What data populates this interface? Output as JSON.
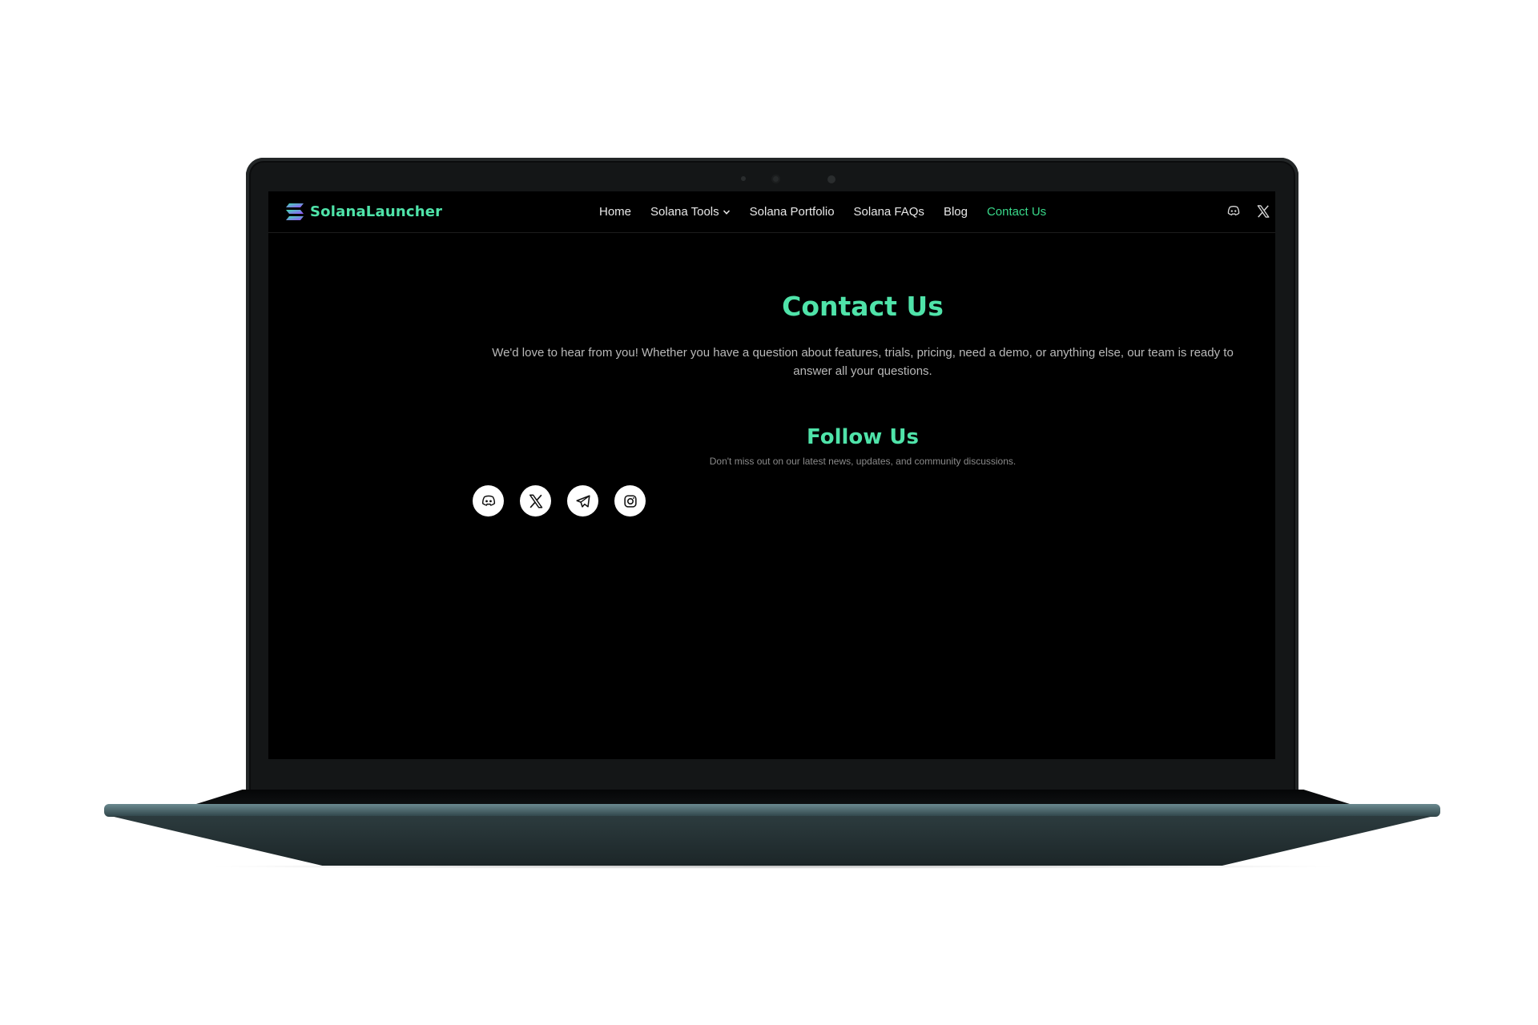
{
  "brand": {
    "name": "SolanaLauncher"
  },
  "nav": {
    "items": [
      {
        "label": "Home"
      },
      {
        "label": "Solana Tools"
      },
      {
        "label": "Solana Portfolio"
      },
      {
        "label": "Solana FAQs"
      },
      {
        "label": "Blog"
      },
      {
        "label": "Contact Us",
        "active": true
      }
    ],
    "social_icons": [
      "discord-icon",
      "x-icon"
    ]
  },
  "contact": {
    "title": "Contact Us",
    "description": "We'd love to hear from you! Whether you have a question about features, trials, pricing, need a demo, or anything else, our team is ready to answer all your questions."
  },
  "follow": {
    "title": "Follow Us",
    "subtitle": "Don't miss out on our latest news, updates, and community discussions.",
    "icons": [
      "discord-icon",
      "x-icon",
      "telegram-icon",
      "instagram-icon"
    ]
  },
  "colors": {
    "accent": "#4fe3a9",
    "active_link": "#39d98a",
    "background": "#000000",
    "nav_text": "#e8e8e8"
  }
}
